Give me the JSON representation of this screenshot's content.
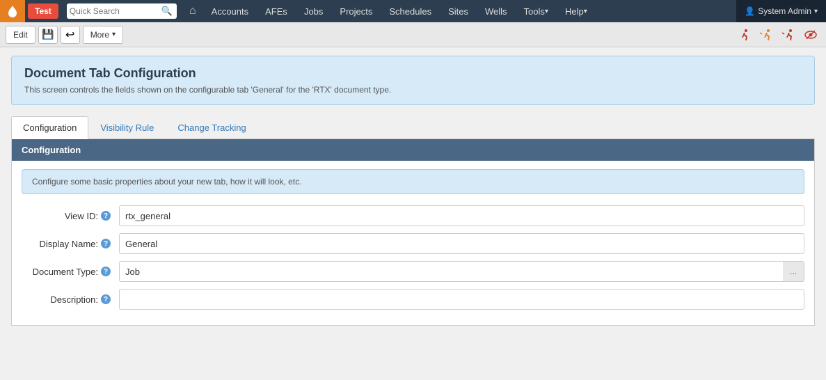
{
  "navbar": {
    "brand_icon": "flame",
    "test_label": "Test",
    "search_placeholder": "Quick Search",
    "home_icon": "home",
    "menu_items": [
      {
        "label": "Accounts",
        "has_arrow": false
      },
      {
        "label": "AFEs",
        "has_arrow": false
      },
      {
        "label": "Jobs",
        "has_arrow": false
      },
      {
        "label": "Projects",
        "has_arrow": false
      },
      {
        "label": "Schedules",
        "has_arrow": false
      },
      {
        "label": "Sites",
        "has_arrow": false
      },
      {
        "label": "Wells",
        "has_arrow": false
      },
      {
        "label": "Tools",
        "has_arrow": true
      },
      {
        "label": "Help",
        "has_arrow": true
      }
    ],
    "user_label": "System Admin"
  },
  "toolbar": {
    "edit_label": "Edit",
    "save_icon": "💾",
    "discard_icon": "↩",
    "more_label": "More",
    "icons_right": [
      {
        "name": "runner-icon-1",
        "symbol": "🏃",
        "color": "#e74c3c"
      },
      {
        "name": "runner-icon-2",
        "symbol": "🏃",
        "color": "#e67e22"
      },
      {
        "name": "runner-icon-3",
        "symbol": "🏃",
        "color": "#e74c3c"
      },
      {
        "name": "eye-icon",
        "symbol": "👁",
        "color": "#555"
      }
    ]
  },
  "info_box": {
    "title": "Document Tab Configuration",
    "description": "This screen controls the fields shown on the configurable tab 'General' for the 'RTX' document type."
  },
  "tabs": [
    {
      "label": "Configuration",
      "active": true
    },
    {
      "label": "Visibility Rule",
      "active": false
    },
    {
      "label": "Change Tracking",
      "active": false
    }
  ],
  "section": {
    "header": "Configuration",
    "config_info": "Configure some basic properties about your new tab, how it will look, etc.",
    "fields": [
      {
        "label": "View ID:",
        "help": true,
        "type": "text",
        "value": "rtx_general",
        "has_btn": false
      },
      {
        "label": "Display Name:",
        "help": true,
        "type": "text",
        "value": "General",
        "has_btn": false
      },
      {
        "label": "Document Type:",
        "help": true,
        "type": "text",
        "value": "Job",
        "has_btn": true,
        "btn_label": "..."
      },
      {
        "label": "Description:",
        "help": true,
        "type": "text",
        "value": "",
        "has_btn": false
      }
    ]
  }
}
